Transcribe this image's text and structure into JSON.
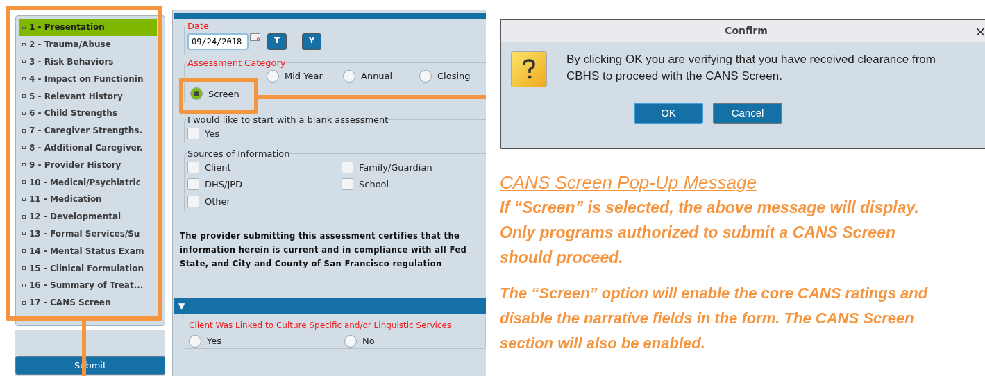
{
  "sidebar": {
    "items": [
      {
        "label": "1 - Presentation",
        "selected": true
      },
      {
        "label": "2 - Trauma/Abuse",
        "selected": false
      },
      {
        "label": "3 - Risk Behaviors",
        "selected": false
      },
      {
        "label": "4 - Impact on Functionin",
        "selected": false
      },
      {
        "label": "5 - Relevant History",
        "selected": false
      },
      {
        "label": "6 - Child Strengths",
        "selected": false
      },
      {
        "label": "7 - Caregiver Strengths.",
        "selected": false
      },
      {
        "label": "8 - Additional Caregiver.",
        "selected": false
      },
      {
        "label": "9 - Provider History",
        "selected": false
      },
      {
        "label": "10 - Medical/Psychiatric",
        "selected": false
      },
      {
        "label": "11 - Medication",
        "selected": false
      },
      {
        "label": "12 - Developmental",
        "selected": false
      },
      {
        "label": "13 - Formal Services/Su",
        "selected": false
      },
      {
        "label": "14 - Mental Status Exam",
        "selected": false
      },
      {
        "label": "15 - Clinical Formulation",
        "selected": false
      },
      {
        "label": "16 - Summary of Treat...",
        "selected": false
      },
      {
        "label": "17 - CANS Screen",
        "selected": false
      }
    ],
    "submit_button": "Submit"
  },
  "form": {
    "date": {
      "label": "Date",
      "value": "09/24/2018",
      "buttons": [
        "T",
        "Y"
      ]
    },
    "assessment_category": {
      "label": "Assessment Category",
      "options": [
        {
          "label": "Mid Year",
          "selected": false
        },
        {
          "label": "Annual",
          "selected": false
        },
        {
          "label": "Closing",
          "selected": false
        },
        {
          "label": "Screen",
          "selected": true
        }
      ]
    },
    "blank_assessment": {
      "label": "I would like to start with a blank assessment",
      "options": [
        {
          "label": "Yes",
          "checked": false
        }
      ]
    },
    "sources": {
      "label": "Sources of Information",
      "options": [
        {
          "label": "Client",
          "checked": false
        },
        {
          "label": "DHS/JPD",
          "checked": false
        },
        {
          "label": "Other",
          "checked": false
        },
        {
          "label": "Family/Guardian",
          "checked": false
        },
        {
          "label": "School",
          "checked": false
        }
      ]
    },
    "certification": [
      "The provider submitting this assessment certifies that the",
      "information herein is current and in compliance with all Fed",
      "State, and City and County of San Francisco regulation"
    ],
    "section_toggle": "▼",
    "linked_services": {
      "label": "Client Was Linked to Culture Specific and/or Linguistic Services",
      "options": [
        {
          "label": "Yes",
          "selected": false
        },
        {
          "label": "No",
          "selected": false
        }
      ]
    }
  },
  "dialog": {
    "title": "Confirm",
    "close": "×",
    "message": "By clicking OK you are verifying that you have received clearance from CBHS to proceed with the CANS Screen.",
    "buttons": [
      "OK",
      "Cancel"
    ]
  },
  "annotation": {
    "title": "CANS Screen Pop-Up Message",
    "paragraphs": [
      [
        "If “Screen” is selected, the above message will display.",
        "Only programs authorized to submit a CANS Screen",
        "should proceed."
      ],
      [
        "The “Screen” option will enable the core CANS ratings and",
        "disable the narrative fields in the form.  The CANS Screen",
        "section will also be enabled."
      ]
    ]
  }
}
